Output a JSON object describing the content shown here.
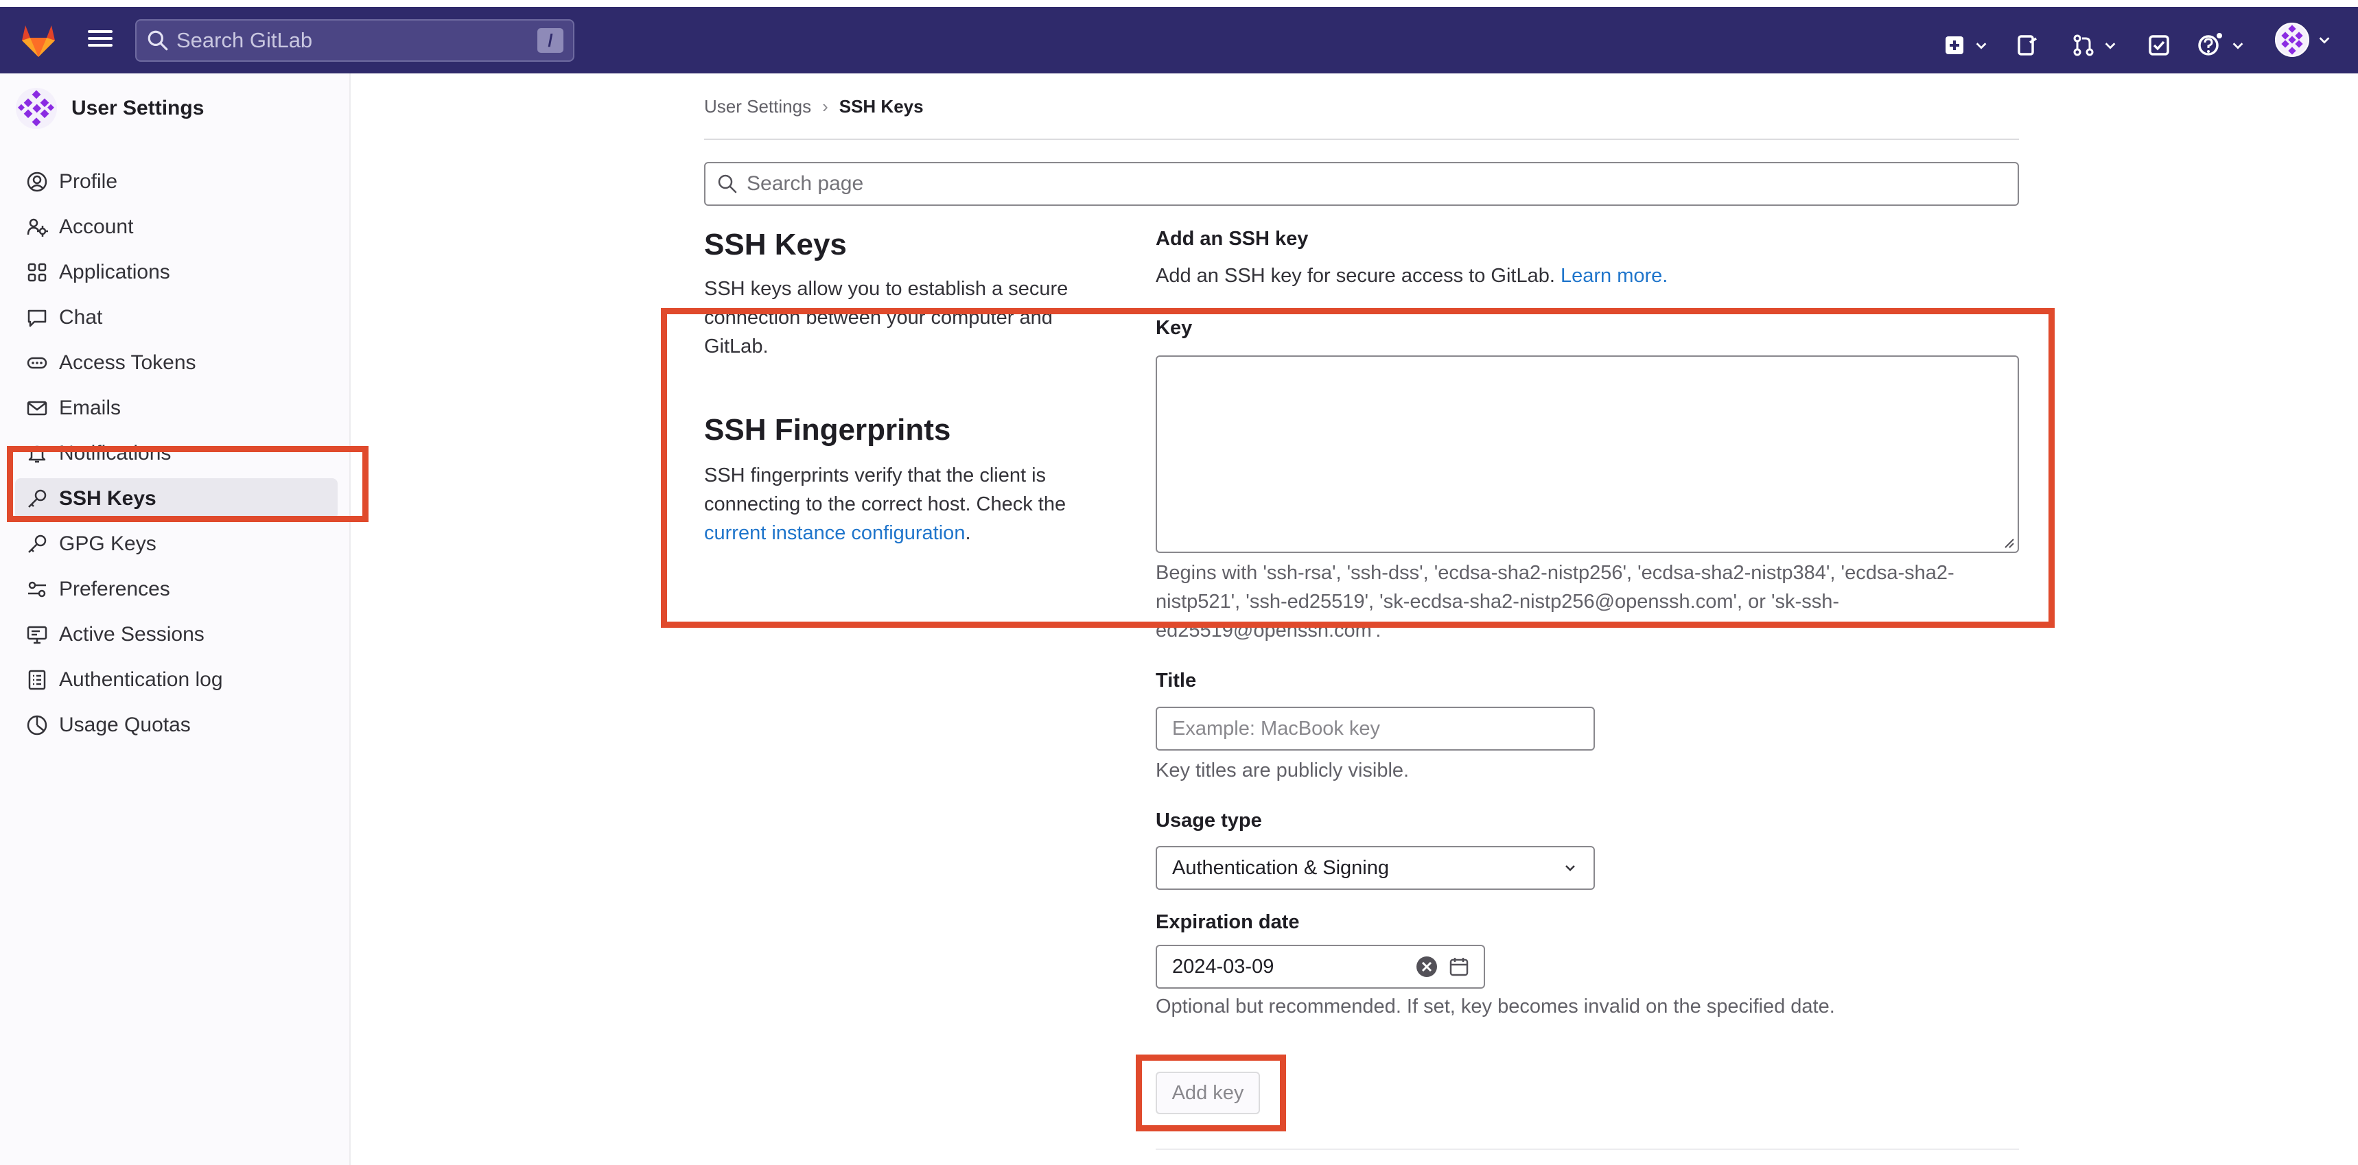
{
  "topbar": {
    "search_placeholder": "Search GitLab",
    "search_shortcut": "/"
  },
  "sidebar": {
    "title": "User Settings",
    "items": [
      {
        "label": "Profile",
        "icon": "profile-icon"
      },
      {
        "label": "Account",
        "icon": "account-icon"
      },
      {
        "label": "Applications",
        "icon": "applications-icon"
      },
      {
        "label": "Chat",
        "icon": "chat-icon"
      },
      {
        "label": "Access Tokens",
        "icon": "token-icon"
      },
      {
        "label": "Emails",
        "icon": "mail-icon"
      },
      {
        "label": "Notifications",
        "icon": "bell-icon"
      },
      {
        "label": "SSH Keys",
        "icon": "key-icon",
        "active": true
      },
      {
        "label": "GPG Keys",
        "icon": "key-icon"
      },
      {
        "label": "Preferences",
        "icon": "preferences-icon"
      },
      {
        "label": "Active Sessions",
        "icon": "monitor-icon"
      },
      {
        "label": "Authentication log",
        "icon": "log-icon"
      },
      {
        "label": "Usage Quotas",
        "icon": "quota-icon"
      }
    ]
  },
  "breadcrumb": {
    "parent": "User Settings",
    "separator": "›",
    "current": "SSH Keys"
  },
  "search_page": {
    "placeholder": "Search page"
  },
  "ssh_keys": {
    "heading": "SSH Keys",
    "description": "SSH keys allow you to establish a secure connection between your computer and GitLab."
  },
  "fingerprints": {
    "heading": "SSH Fingerprints",
    "description_before": "SSH fingerprints verify that the client is connecting to the correct host. Check the ",
    "link": "current instance configuration",
    "description_after": "."
  },
  "form": {
    "title": "Add an SSH key",
    "intro": "Add an SSH key for secure access to GitLab.",
    "intro_link": "Learn more.",
    "key_label": "Key",
    "key_value": "",
    "key_help_line1": "Begins with 'ssh-rsa', 'ssh-dss', 'ecdsa-sha2-nistp256', 'ecdsa-sha2-nistp384', 'ecdsa-sha2-",
    "key_help_line2": "nistp521', 'ssh-ed25519', 'sk-ecdsa-sha2-nistp256@openssh.com', or 'sk-ssh-",
    "key_help_line3": "ed25519@openssh.com'.",
    "title_label": "Title",
    "title_placeholder": "Example: MacBook key",
    "title_help": "Key titles are publicly visible.",
    "usage_label": "Usage type",
    "usage_value": "Authentication & Signing",
    "expiration_label": "Expiration date",
    "expiration_value": "2024-03-09",
    "expiration_help": "Optional but recommended. If set, key becomes invalid on the specified date.",
    "submit_label": "Add key"
  },
  "colors": {
    "topbar": "#2f2a6b",
    "link": "#1f75cb",
    "annotation": "#e04a2c",
    "active_item": "#e9e8ee"
  }
}
